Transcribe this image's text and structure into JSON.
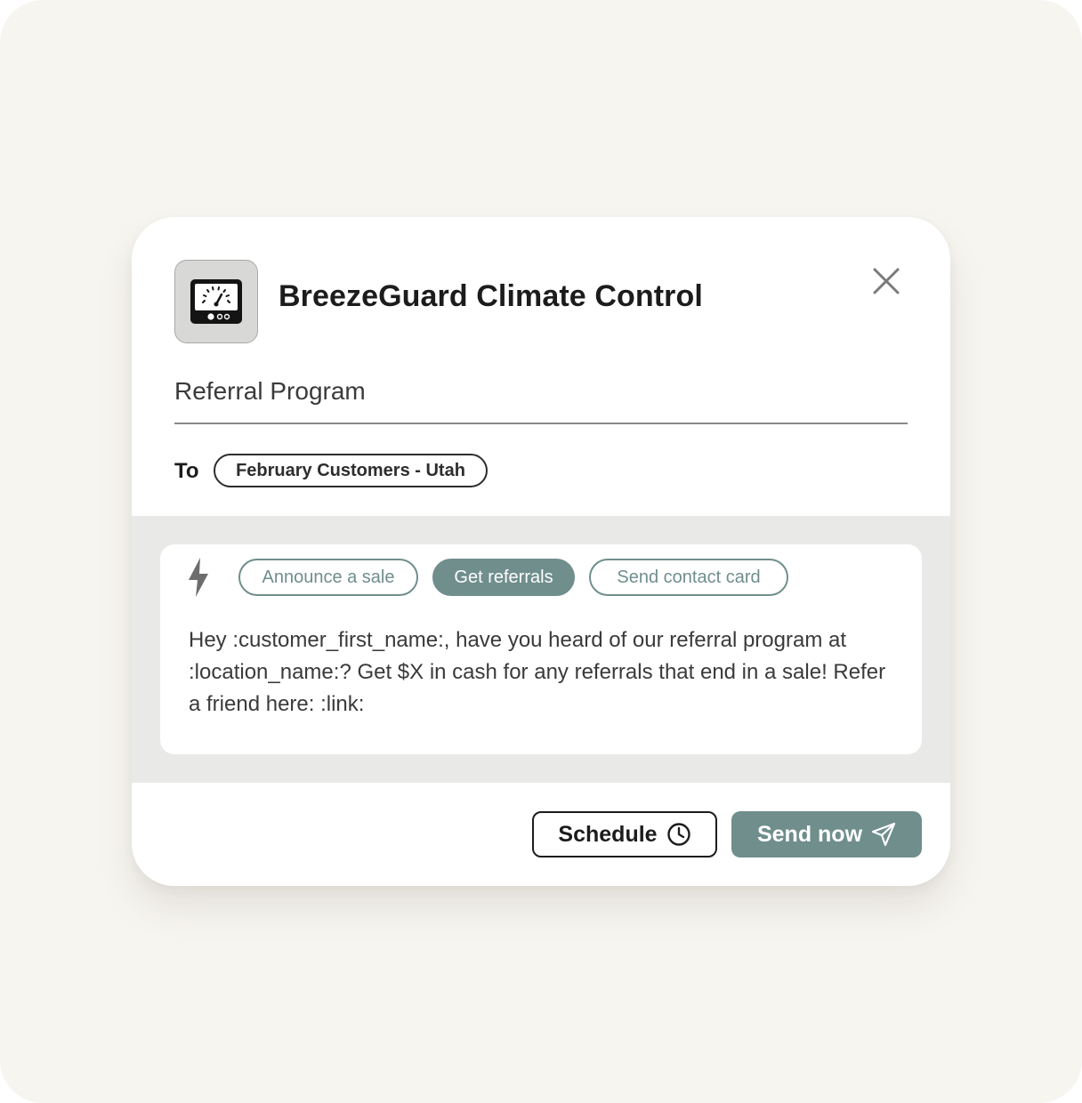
{
  "app": {
    "name": "BreezeGuard Climate Control",
    "icon": "gauge-meter-icon"
  },
  "subject": "Referral Program",
  "recipients": {
    "label": "To",
    "chip": "February Customers - Utah"
  },
  "templates": {
    "icon": "lightning-bolt-icon",
    "items": [
      {
        "label": "Announce a sale",
        "active": false
      },
      {
        "label": "Get referrals",
        "active": true
      },
      {
        "label": "Send contact card",
        "active": false
      }
    ]
  },
  "message": "Hey :customer_first_name:, have you heard of our referral program at :location_name:? Get $X in cash for any referrals that end in a sale! Refer a friend here: :link:",
  "actions": {
    "schedule_label": "Schedule",
    "schedule_icon": "clock-icon",
    "send_label": "Send now",
    "send_icon": "paper-plane-icon"
  },
  "colors": {
    "accent": "#6f8e8c",
    "background": "#f7f5f0",
    "compose_band": "#e9e9e7"
  }
}
